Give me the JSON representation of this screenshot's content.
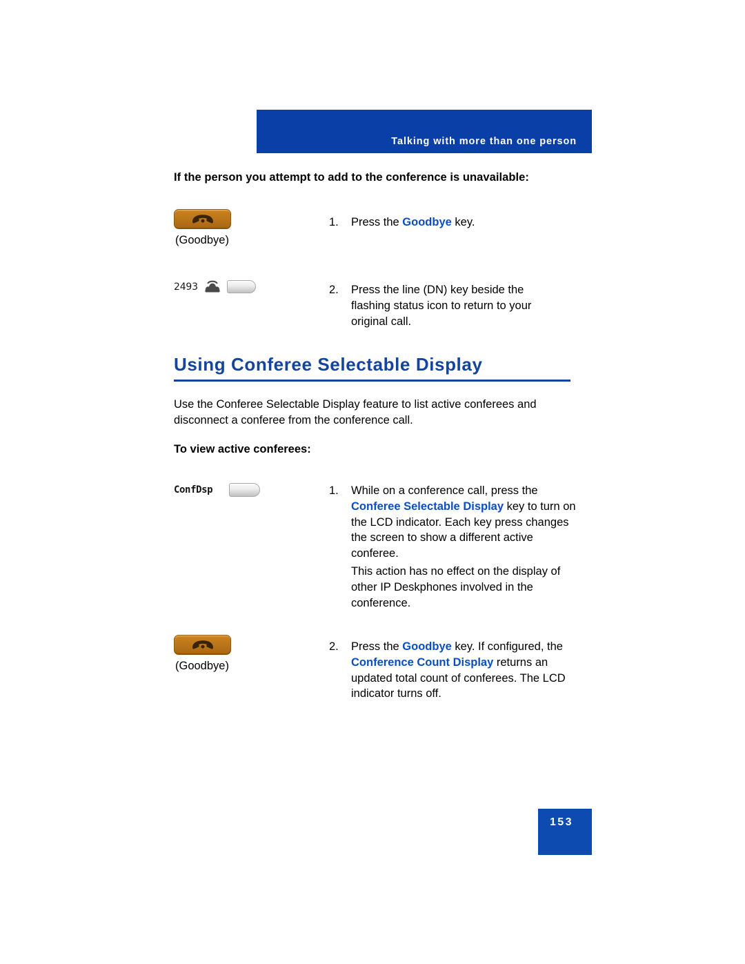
{
  "header": {
    "running_title": "Talking with more than one person"
  },
  "intro": {
    "lead_bold": "If the person you attempt to add to the conference is unavailable:"
  },
  "steps_unavailable": [
    {
      "number": "1.",
      "art": "goodbye-key",
      "caption": "(Goodbye)",
      "text_parts": [
        {
          "text": "Press the ",
          "accent": false
        },
        {
          "text": "Goodbye",
          "accent": true
        },
        {
          "text": " key.",
          "accent": false
        }
      ],
      "plain_text": "Press the Goodbye key."
    },
    {
      "number": "2.",
      "art": "dn-line-key",
      "dn_number": "2493",
      "caption": "",
      "text_parts": [
        {
          "text": "Press the line (DN) key beside the flashing status icon to return to your original call.",
          "accent": false
        }
      ],
      "plain_text": "Press the line (DN) key beside the flashing status icon to return to your original call."
    }
  ],
  "section": {
    "heading": "Using Conferee Selectable Display",
    "body": "Use the Conferee Selectable Display feature to list active conferees and disconnect a conferee from the conference call.",
    "sub_heading": "To view active conferees:"
  },
  "steps_view_conferees": [
    {
      "number": "1.",
      "art": "confdsp-key",
      "lcd_label": "ConfDsp",
      "caption": "",
      "text_parts": [
        {
          "text": "While on a conference call, press the ",
          "accent": false
        },
        {
          "text": "Conferee Selectable Display",
          "accent": true
        },
        {
          "text": " key to turn on the LCD indicator. Each key press changes the screen to show a different active conferee.",
          "accent": false
        }
      ],
      "plain_text": "While on a conference call, press the Conferee Selectable Display key to turn on the LCD indicator. Each key press changes the screen to show a different active conferee.",
      "note": "This action has no effect on the display of other IP Deskphones involved in the conference."
    },
    {
      "number": "2.",
      "art": "goodbye-key",
      "caption": "(Goodbye)",
      "text_parts": [
        {
          "text": "Press the ",
          "accent": false
        },
        {
          "text": "Goodbye",
          "accent": true
        },
        {
          "text": " key. If configured, the ",
          "accent": false
        },
        {
          "text": "Conference Count Display",
          "accent": true
        },
        {
          "text": " returns an updated total count of conferees. The LCD indicator turns off.",
          "accent": false
        }
      ],
      "plain_text": "Press the Goodbye key. If configured, the Conference Count Display returns an updated total count of conferees. The LCD indicator turns off."
    }
  ],
  "footer": {
    "page_number": "153"
  },
  "colors": {
    "banner_blue": "#0a3fa8",
    "heading_blue": "#13449e",
    "accent_blue": "#0a4fc0",
    "page_box_blue": "#0e4bb0",
    "key_orange": "#c77f1d"
  }
}
